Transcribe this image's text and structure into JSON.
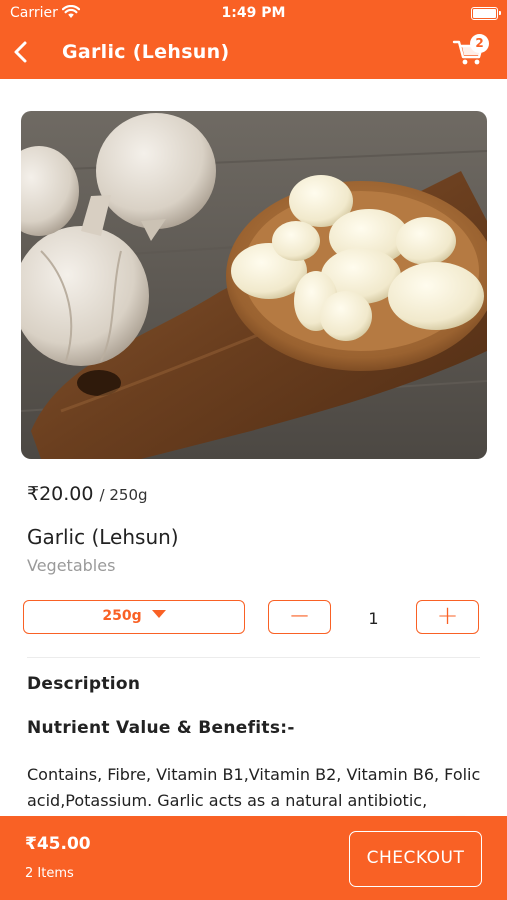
{
  "status_bar": {
    "carrier": "Carrier",
    "time": "1:49 PM"
  },
  "header": {
    "title": "Garlic (Lehsun)",
    "cart_count": "2",
    "icons": [
      "back-arrow-icon",
      "cart-icon"
    ]
  },
  "product": {
    "price": "₹20.00",
    "unit": "/ 250g",
    "name": "Garlic (Lehsun)",
    "category": "Vegetables",
    "selected_weight": "250g",
    "quantity": "1",
    "minus_label": "−",
    "plus_label": "+"
  },
  "details": {
    "description_heading": "Description",
    "nutrient_heading": "Nutrient Value & Benefits:-",
    "nutrient_text": "Contains, Fibre, Vitamin B1,Vitamin B2, Vitamin B6, Folic acid,Potassium. Garlic acts as a natural antibiotic,"
  },
  "footer": {
    "total": "₹45.00",
    "items": "2 Items",
    "checkout_label": "CHECKOUT"
  },
  "colors": {
    "accent": "#f96125",
    "text": "#222222",
    "muted": "#9a9a9a"
  }
}
